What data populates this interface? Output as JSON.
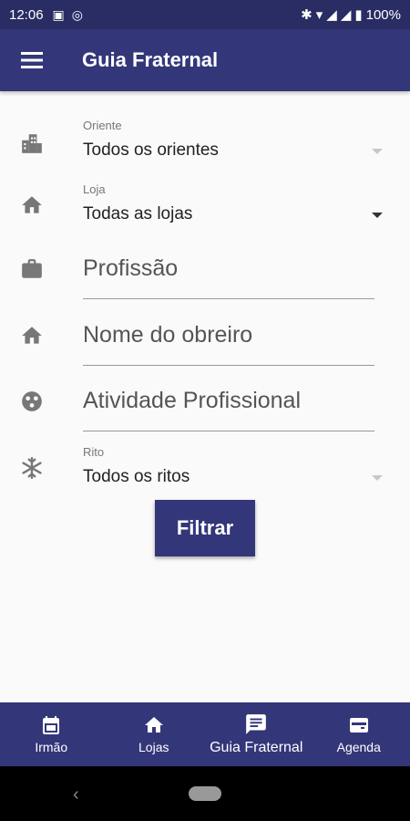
{
  "status": {
    "time": "12:06",
    "battery": "100%"
  },
  "app_bar": {
    "title": "Guia Fraternal"
  },
  "form": {
    "oriente": {
      "label": "Oriente",
      "value": "Todos os orientes"
    },
    "loja": {
      "label": "Loja",
      "value": "Todas as lojas"
    },
    "profissao": {
      "placeholder": "Profissão"
    },
    "obreiro": {
      "placeholder": "Nome do obreiro"
    },
    "atividade": {
      "placeholder": "Atividade Profissional"
    },
    "rito": {
      "label": "Rito",
      "value": "Todos os ritos"
    },
    "filter_label": "Filtrar"
  },
  "bottom_nav": {
    "items": [
      {
        "label": "Irmão",
        "icon": "calendar-icon"
      },
      {
        "label": "Lojas",
        "icon": "home-icon"
      },
      {
        "label": "Guia Fraternal",
        "icon": "message-icon"
      },
      {
        "label": "Agenda",
        "icon": "card-icon"
      }
    ],
    "active_index": 2
  },
  "colors": {
    "primary": "#34367a",
    "status_bar": "#2a2d63",
    "background": "#fafafa"
  }
}
